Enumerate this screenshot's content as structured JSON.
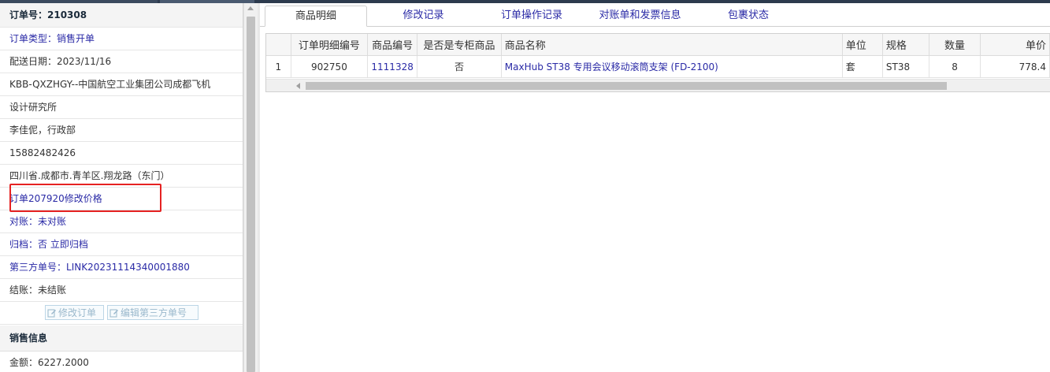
{
  "order": {
    "header": "订单号：210308",
    "type_key": "订单类型：",
    "type_value": "销售开单",
    "delivery": "配送日期：2023/11/16",
    "customer_line1": "KBB-QXZHGY--中国航空工业集团公司成都飞机",
    "customer_line2": "设计研究所",
    "contact": "李佳伲，行政部",
    "phone": "15882482426",
    "address": "四川省.成都市.青羊区.翔龙路（东门）",
    "note": "订单207920修改价格",
    "recon_key": "对账：",
    "recon_value": "未对账",
    "archive_key": "归档：",
    "archive_value": "否 立即归档",
    "thirdparty_key": "第三方单号：",
    "thirdparty_value": "LINK20231114340001880",
    "settle": "结账：未结账",
    "edit_order_btn": "修改订单",
    "edit_third_btn": "编辑第三方单号"
  },
  "sales": {
    "title": "销售信息",
    "amount": "金额：6227.2000"
  },
  "tabs": [
    {
      "label": "商品明细"
    },
    {
      "label": "修改记录"
    },
    {
      "label": "订单操作记录"
    },
    {
      "label": "对账单和发票信息"
    },
    {
      "label": "包裹状态"
    }
  ],
  "table": {
    "headers": [
      "",
      "订单明细编号",
      "商品编号",
      "是否是专柜商品",
      "商品名称",
      "单位",
      "规格",
      "数量",
      "单价"
    ],
    "rows": [
      [
        "1",
        "902750",
        "1111328",
        "否",
        "MaxHub ST38 专用会议移动滚筒支架 (FD-2100)",
        "套",
        "ST38",
        "8",
        "778.4"
      ]
    ]
  },
  "icons": {
    "edit": "edit-icon"
  },
  "colors": {
    "link": "#2a2aa6",
    "highlight": "#e52222"
  }
}
